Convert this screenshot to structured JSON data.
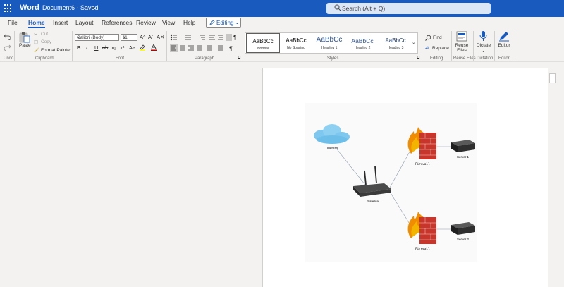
{
  "titlebar": {
    "app_name": "Word",
    "document_name": "Document6 - Saved",
    "doc_chevron": "⌄",
    "search_placeholder": "Search (Alt + Q)"
  },
  "tabs": [
    "File",
    "Home",
    "Insert",
    "Layout",
    "References",
    "Review",
    "View",
    "Help"
  ],
  "active_tab": "Home",
  "editing_mode": "Editing",
  "ribbon": {
    "undo_label": "Undo",
    "clipboard": {
      "paste": "Paste",
      "cut": "Cut",
      "copy": "Copy",
      "format_painter": "Format Painter",
      "group_label": "Clipboard"
    },
    "font": {
      "font_name": "Calibri (Body)",
      "font_size": "11",
      "grow": "A^",
      "shrink": "Aˇ",
      "clear": "A✕",
      "bold": "B",
      "italic": "I",
      "underline": "U",
      "strike": "ab",
      "subscript": "x₂",
      "superscript": "x²",
      "case": "Aa",
      "group_label": "Font"
    },
    "paragraph": {
      "group_label": "Paragraph"
    },
    "styles": {
      "items": [
        {
          "preview": "AaBbCc",
          "name": "Normal"
        },
        {
          "preview": "AaBbCc",
          "name": "No Spacing"
        },
        {
          "preview": "AaBbCc",
          "name": "Heading 1"
        },
        {
          "preview": "AaBbCc",
          "name": "Heading 2"
        },
        {
          "preview": "AaBbCc",
          "name": "Heading 3"
        }
      ],
      "group_label": "Styles"
    },
    "editing": {
      "find": "Find",
      "replace": "Replace",
      "group_label": "Editing"
    },
    "reuse_files": {
      "button": "Reuse Files",
      "group_label": "Reuse Files"
    },
    "dictation": {
      "button": "Dictate",
      "group_label": "Dictation"
    },
    "editor": {
      "button": "Editor",
      "group_label": "Editor"
    }
  },
  "diagram": {
    "internet_label": "Internet",
    "satellite_label": "Satellite",
    "firewall_top_label": "Firewall",
    "firewall_bottom_label": "Firewall",
    "server1_label": "Server 1",
    "server2_label": "Server 2"
  },
  "colors": {
    "brand_blue": "#185abd",
    "ribbon_bg": "#f3f2f1",
    "search_bg": "#dbe6f7"
  }
}
